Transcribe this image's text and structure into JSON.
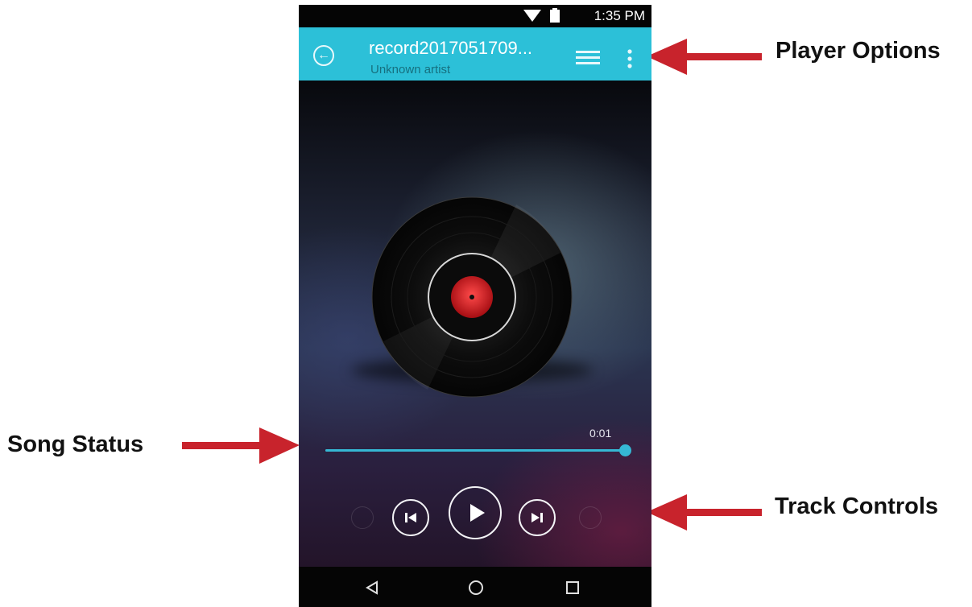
{
  "callouts": {
    "player_options": "Player Options",
    "song_status": "Song Status",
    "track_controls": "Track Controls"
  },
  "status_bar": {
    "time": "1:35 PM",
    "icons": [
      "wifi-icon",
      "battery-icon"
    ]
  },
  "app_bar": {
    "title": "record2017051709...",
    "artist": "Unknown artist",
    "back_icon": "arrow-left-circle-icon",
    "playlist_icon": "playlist-icon",
    "more_icon": "more-vertical-icon",
    "color": "#2cc0d8"
  },
  "player": {
    "album_art": "vinyl-disc",
    "elapsed": "0:01",
    "progress_fraction": 1.0,
    "accent_color": "#35b8d4"
  },
  "controls": [
    "shuffle-icon",
    "skip-previous-icon",
    "play-icon",
    "skip-next-icon",
    "repeat-icon"
  ],
  "nav_bar": [
    "nav-back-icon",
    "nav-home-icon",
    "nav-recents-icon"
  ],
  "arrow_color": "#c8232c"
}
